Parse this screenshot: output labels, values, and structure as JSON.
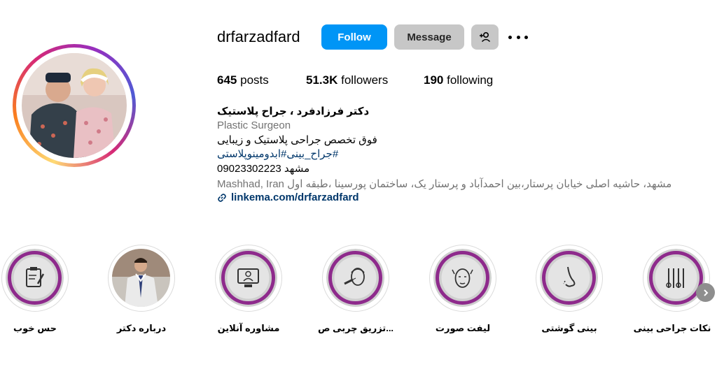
{
  "profile": {
    "username": "drfarzadfard",
    "follow_label": "Follow",
    "message_label": "Message",
    "stats": {
      "posts_count": "645",
      "posts_label": "posts",
      "followers_count": "51.3K",
      "followers_label": "followers",
      "following_count": "190",
      "following_label": "following"
    },
    "bio": {
      "full_name": "دکتر فرزادفرد ، جراح پلاستیک",
      "category": "Plastic Surgeon",
      "line1": "فوق تخصص جراحی پلاستیک و زیبایی",
      "hashtags": "#جراح_بینی#ابدومینوپلاستی",
      "line3": "مشهد 09023302223",
      "address": "Mashhad, Iran مشهد، حاشیه اصلی خیابان پرستار،بین احمدآباد و پرستار یک، ساختمان پورسینا ،طبقه اول",
      "link": "linkema.com/drfarzadfard"
    }
  },
  "highlights": [
    {
      "label": "حس خوب",
      "icon": "clipboard-edit-icon"
    },
    {
      "label": "درباره دکتر",
      "icon": "doctor-photo"
    },
    {
      "label": "مشاوره آنلاین",
      "icon": "online-consult-icon"
    },
    {
      "label": "تزریق چربی ص...",
      "icon": "face-injection-icon"
    },
    {
      "label": "لیفت صورت",
      "icon": "face-lift-icon"
    },
    {
      "label": "بینی گوشتی",
      "icon": "nose-icon"
    },
    {
      "label": "نکات جراحی بینی",
      "icon": "surgical-tools-icon"
    }
  ],
  "colors": {
    "follow_blue": "#0095f6",
    "secondary_gray": "#c7c7c7",
    "link_blue": "#00376b",
    "muted_text": "#737373",
    "highlight_purple": "#8e2a8c"
  }
}
